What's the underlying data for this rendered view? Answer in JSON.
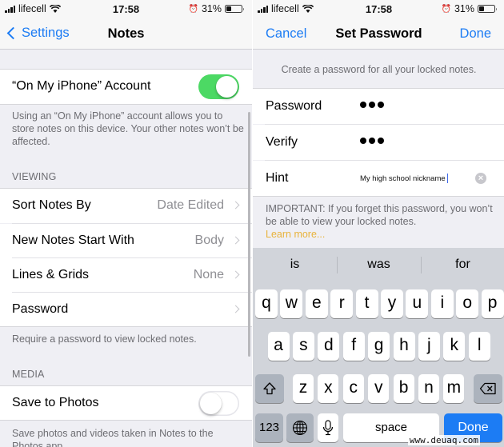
{
  "status_bar": {
    "carrier": "lifecell",
    "time": "17:58",
    "battery_percent": "31%",
    "battery_level": 0.31,
    "icons": [
      "signal-icon",
      "wifi-icon",
      "alarm-icon",
      "battery-icon"
    ]
  },
  "left_screen": {
    "nav": {
      "back_label": "Settings",
      "title": "Notes"
    },
    "account": {
      "label": "“On My iPhone” Account",
      "toggle_on": true,
      "footer": "Using an “On My iPhone” account allows you to store notes on this device. Your other notes won’t be affected."
    },
    "viewing": {
      "header": "VIEWING",
      "items": [
        {
          "label": "Sort Notes By",
          "value": "Date Edited"
        },
        {
          "label": "New Notes Start With",
          "value": "Body"
        },
        {
          "label": "Lines & Grids",
          "value": "None"
        },
        {
          "label": "Password",
          "value": ""
        }
      ],
      "footer": "Require a password to view locked notes."
    },
    "media": {
      "header": "MEDIA",
      "save_to_photos_label": "Save to Photos",
      "toggle_on": false,
      "footer": "Save photos and videos taken in Notes to the Photos app."
    }
  },
  "right_screen": {
    "nav": {
      "cancel_label": "Cancel",
      "title": "Set Password",
      "done_label": "Done"
    },
    "caption": "Create a password for all your locked notes.",
    "fields": {
      "password_label": "Password",
      "password_masked_length": 3,
      "verify_label": "Verify",
      "verify_masked_length": 3,
      "hint_label": "Hint",
      "hint_value": "My high school nickname"
    },
    "footer": "IMPORTANT: If you forget this password, you won’t be able to view your locked notes.",
    "learn_more": "Learn more...",
    "accent_link_color": "#e8b33c"
  },
  "keyboard": {
    "predictions": [
      "is",
      "was",
      "for"
    ],
    "row1": [
      "q",
      "w",
      "e",
      "r",
      "t",
      "y",
      "u",
      "i",
      "o",
      "p"
    ],
    "row2": [
      "a",
      "s",
      "d",
      "f",
      "g",
      "h",
      "j",
      "k",
      "l"
    ],
    "row3": [
      "z",
      "x",
      "c",
      "v",
      "b",
      "n",
      "m"
    ],
    "numbers_label": "123",
    "space_label": "space",
    "done_label": "Done"
  },
  "watermark": "www.deuaq.com",
  "colors": {
    "accent": "#1c7cf4",
    "toggle_on": "#4cd964",
    "background": "#efeff4"
  }
}
